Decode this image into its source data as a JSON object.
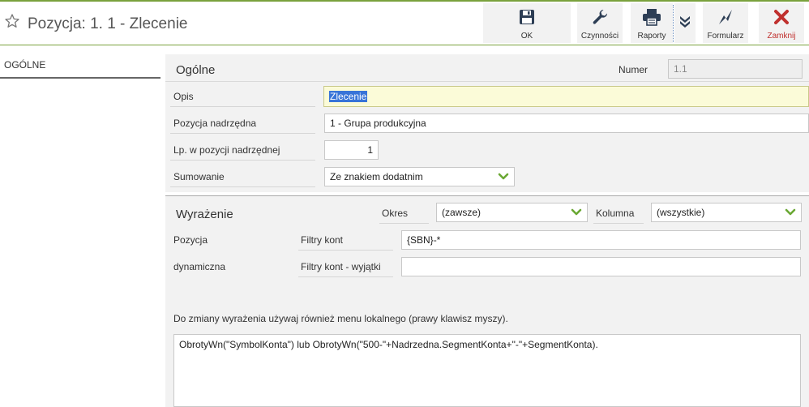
{
  "header": {
    "title": "Pozycja: 1. 1 - Zlecenie",
    "favorite_icon": "star-outline-icon"
  },
  "toolbar": {
    "ok": {
      "label": "OK",
      "icon": "save-disk-icon"
    },
    "actions": {
      "label": "Czynności",
      "icon": "wrench-icon"
    },
    "reports": {
      "label": "Raporty",
      "icon": "printer-icon"
    },
    "more": {
      "icon": "double-chevron-down-icon"
    },
    "form": {
      "label": "Formularz",
      "icon": "lightning-icon"
    },
    "close": {
      "label": "Zamknij",
      "icon": "close-x-icon"
    }
  },
  "colors": {
    "accent": "#7aa23d",
    "close": "#c0302e",
    "chevron": "#6aa834",
    "selection": "#3874d8",
    "active_field": "#fbfbd8"
  },
  "sidebar": {
    "tabs": [
      {
        "label": "OGÓLNE"
      }
    ]
  },
  "general": {
    "title": "Ogólne",
    "number_label": "Numer",
    "number_value": "1.1",
    "description_label": "Opis",
    "description_value": "Zlecenie",
    "parent_label": "Pozycja nadrzędna",
    "parent_value": "1 - Grupa produkcyjna",
    "ordinal_label": "Lp. w pozycji nadrzędnej",
    "ordinal_value": "1",
    "summation_label": "Sumowanie",
    "summation_value": "Ze znakiem dodatnim"
  },
  "expression": {
    "title": "Wyrażenie",
    "period_label": "Okres",
    "period_value": "(zawsze)",
    "column_label": "Kolumna",
    "column_value": "(wszystkie)",
    "dynamic_label_1": "Pozycja",
    "dynamic_label_2": "dynamiczna",
    "account_filters_label": "Filtry kont",
    "account_filters_value": "{SBN}-*",
    "account_exceptions_label": "Filtry kont - wyjątki",
    "account_exceptions_value": "",
    "hint": "Do zmiany wyrażenia używaj również menu lokalnego (prawy klawisz myszy).",
    "formula": "ObrotyWn(\"SymbolKonta\") lub ObrotyWn(\"500-\"+Nadrzedna.SegmentKonta+\"-\"+SegmentKonta)."
  }
}
